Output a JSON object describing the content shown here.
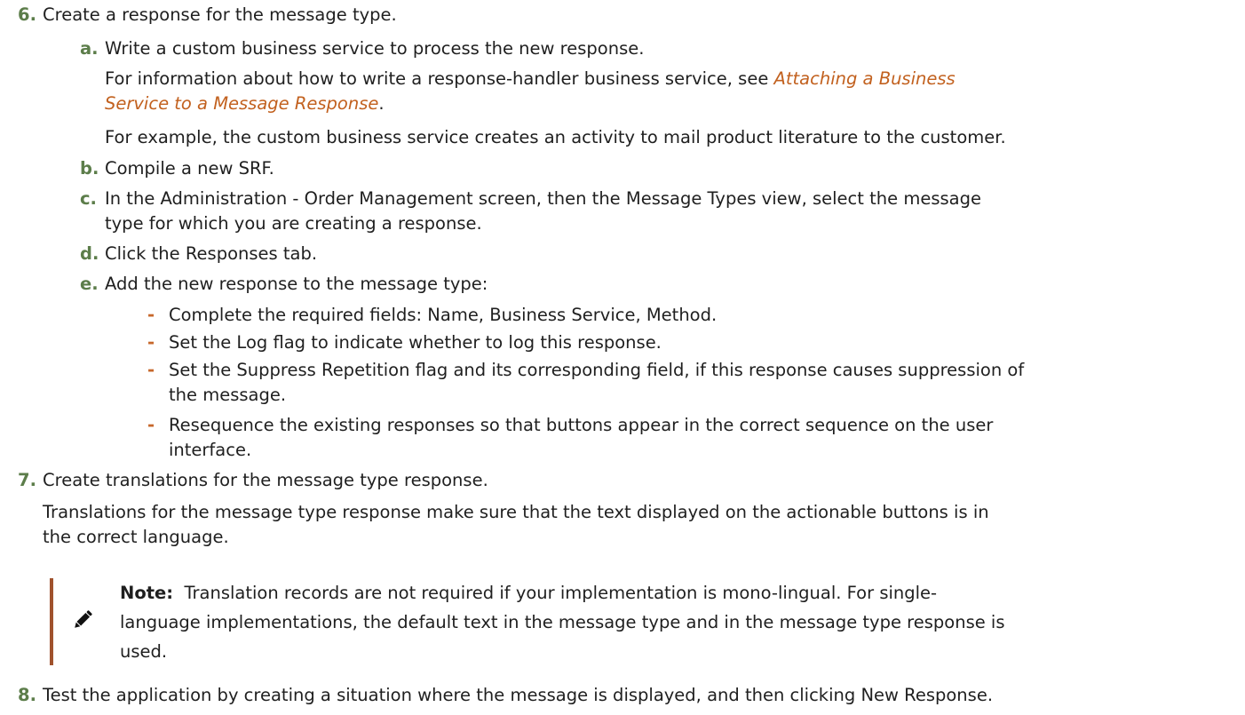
{
  "steps": {
    "s6": {
      "number": "6.",
      "text": "Create a response for the message type.",
      "a": {
        "label": "a.",
        "text": "Write a custom business service to process the new response.",
        "info_prefix": "For information about how to write a response-handler business service, see ",
        "link_line1": "Attaching a Business",
        "link_line2": "Service to a Message Response",
        "info_suffix": ".",
        "example": "For example, the custom business service creates an activity to mail product literature to the customer."
      },
      "b": {
        "label": "b.",
        "text": "Compile a new SRF."
      },
      "c": {
        "label": "c.",
        "line1": "In the Administration - Order Management screen, then the Message Types view, select the message",
        "line2": "type for which you are creating a response."
      },
      "d": {
        "label": "d.",
        "text": "Click the Responses tab."
      },
      "e": {
        "label": "e.",
        "text": "Add the new response to the message type:",
        "bullets": [
          {
            "marker": "-",
            "line1": "Complete the required fields: Name, Business Service, Method.",
            "line2": ""
          },
          {
            "marker": "-",
            "line1": "Set the Log flag to indicate whether to log this response.",
            "line2": ""
          },
          {
            "marker": "-",
            "line1": "Set the Suppress Repetition flag and its corresponding field, if this response causes suppression of",
            "line2": "the message."
          },
          {
            "marker": "-",
            "line1": "Resequence the existing responses so that buttons appear in the correct sequence on the user",
            "line2": "interface."
          }
        ]
      }
    },
    "s7": {
      "number": "7.",
      "text": "Create translations for the message type response.",
      "para_line1": "Translations for the message type response make sure that the text displayed on the actionable buttons is in",
      "para_line2": "the correct language.",
      "note": {
        "icon": "pencil-icon",
        "label": "Note:",
        "line1": "Translation records are not required if your implementation is mono-lingual. For single-",
        "line2": "language implementations, the default text in the message type and in the message type response is",
        "line3": "used."
      }
    },
    "s8": {
      "number": "8.",
      "text": "Test the application by creating a situation where the message is displayed, and then clicking New Response."
    }
  },
  "colors": {
    "step_number": "#5c7d4a",
    "link": "#c2611f",
    "bullet_dash": "#c7682c",
    "note_bar": "#a0522d",
    "text": "#1f1f1f"
  }
}
